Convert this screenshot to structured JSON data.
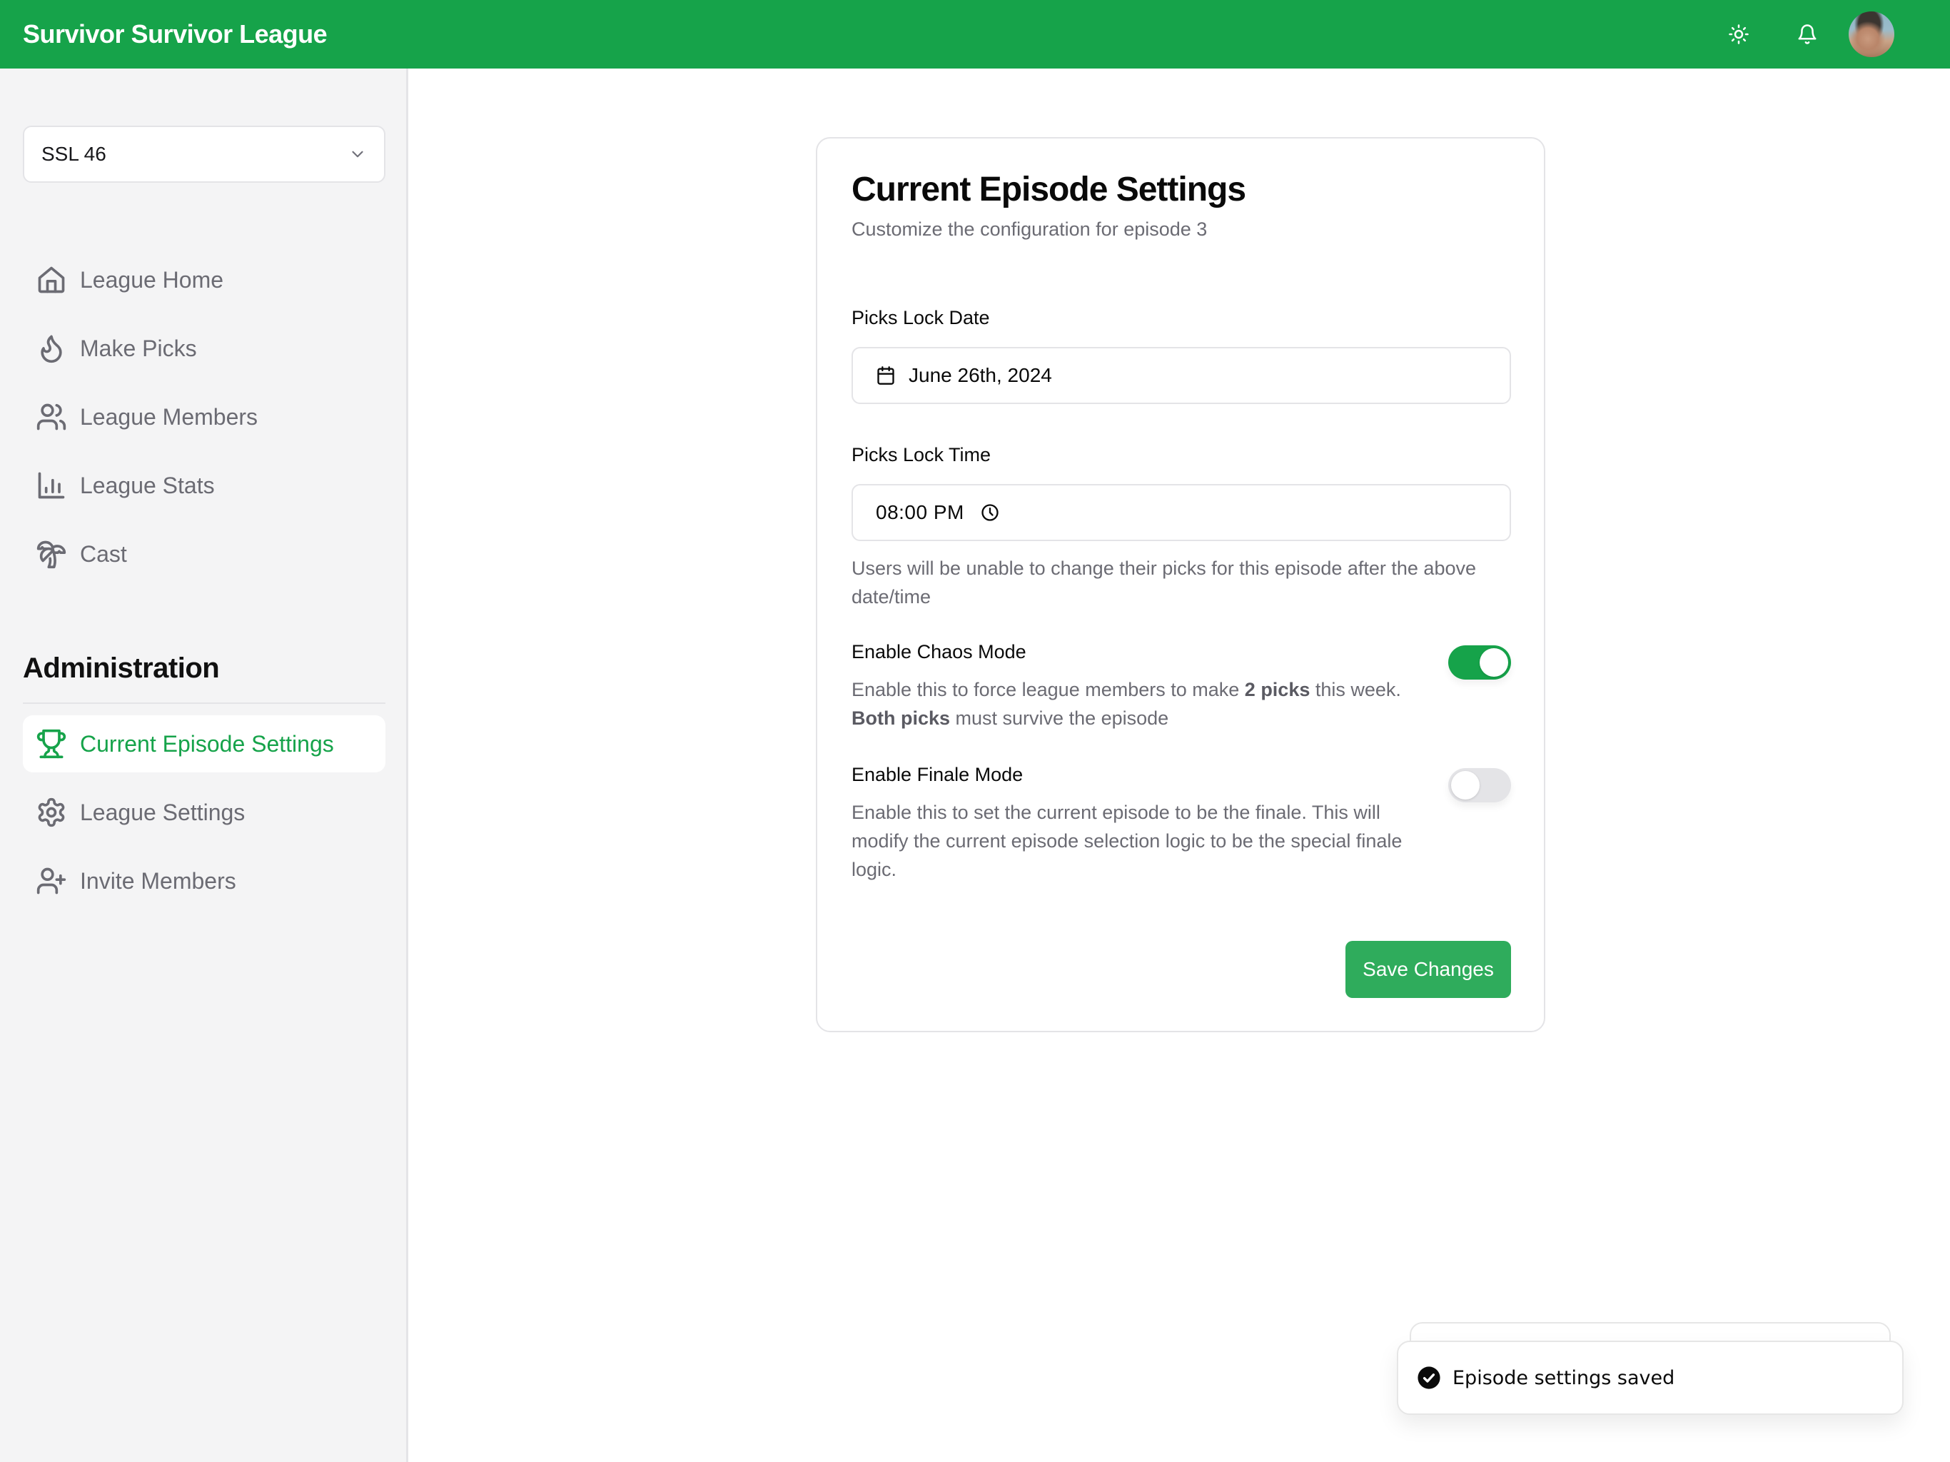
{
  "header": {
    "title": "Survivor Survivor League",
    "icons": [
      "sun-icon",
      "bell-icon"
    ],
    "avatar_alt": "user avatar",
    "brand_color": "#16a34a"
  },
  "sidebar": {
    "league_select": {
      "value": "SSL 46"
    },
    "nav": [
      {
        "label": "League Home",
        "icon": "home-icon"
      },
      {
        "label": "Make Picks",
        "icon": "flame-icon"
      },
      {
        "label": "League Members",
        "icon": "users-icon"
      },
      {
        "label": "League Stats",
        "icon": "bar-chart-icon"
      },
      {
        "label": "Cast",
        "icon": "palm-tree-icon"
      }
    ],
    "admin_heading": "Administration",
    "admin_nav": [
      {
        "label": "Current Episode Settings",
        "icon": "trophy-icon",
        "active": true
      },
      {
        "label": "League Settings",
        "icon": "gear-icon",
        "active": false
      },
      {
        "label": "Invite Members",
        "icon": "user-plus-icon",
        "active": false
      }
    ]
  },
  "card": {
    "title": "Current Episode Settings",
    "subtitle": "Customize the configuration for episode 3",
    "lock_date": {
      "label": "Picks Lock Date",
      "value": "June 26th, 2024"
    },
    "lock_time": {
      "label": "Picks Lock Time",
      "value": "08:00 PM"
    },
    "lock_help": "Users will be unable to change their picks for this episode after the above date/time",
    "chaos": {
      "label": "Enable Chaos Mode",
      "enabled": true,
      "desc_1": "Enable this to force league members to make ",
      "desc_bold_1": "2 picks",
      "desc_2": " this week. ",
      "desc_bold_2": "Both picks",
      "desc_3": " must survive the episode"
    },
    "finale": {
      "label": "Enable Finale Mode",
      "enabled": false,
      "desc": "Enable this to set the current episode to be the finale. This will modify the current episode selection logic to be the special finale logic."
    },
    "save_label": "Save Changes"
  },
  "toast": {
    "message": "Episode settings saved",
    "icon": "check-circle-icon"
  }
}
